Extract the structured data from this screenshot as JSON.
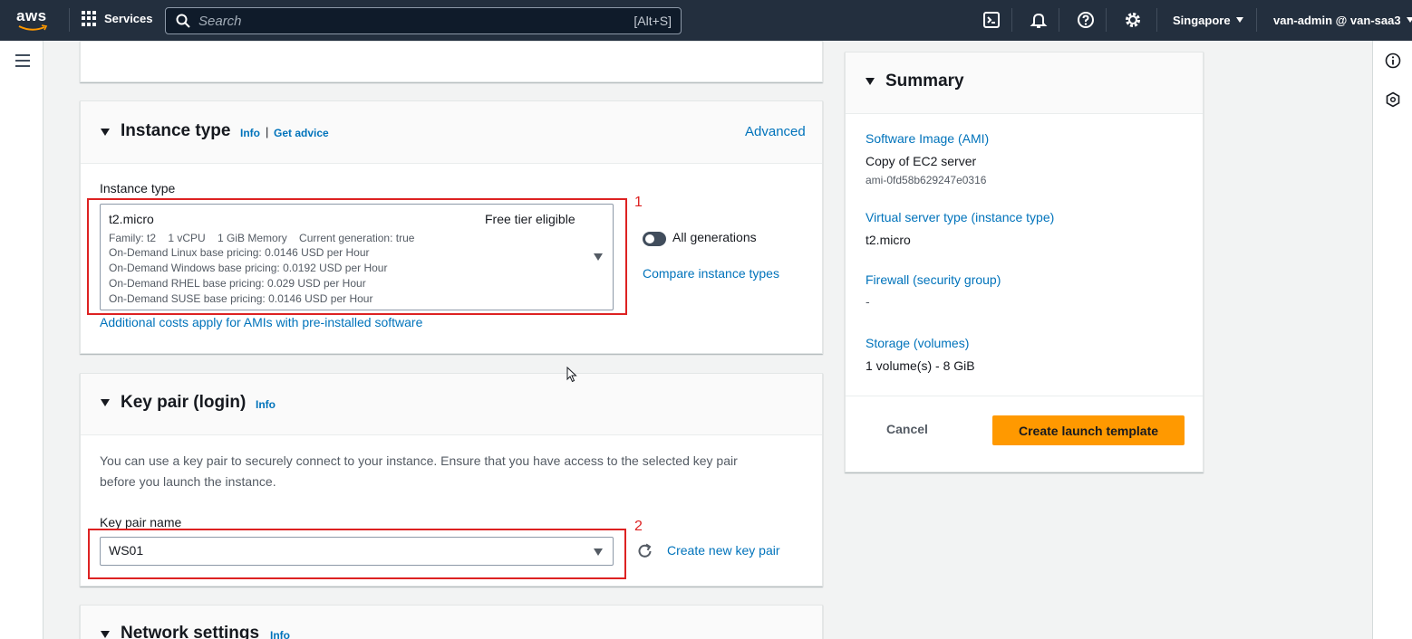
{
  "topnav": {
    "logo": "aws",
    "services_label": "Services",
    "search_placeholder": "Search",
    "search_shortcut": "[Alt+S]",
    "region": "Singapore",
    "account": "van-admin @ van-saa3",
    "icons": [
      "cloudshell-icon",
      "bell-icon",
      "help-icon",
      "gear-icon"
    ]
  },
  "instance_type_section": {
    "title": "Instance type",
    "info": "Info",
    "divider": "|",
    "get_advice": "Get advice",
    "advanced": "Advanced",
    "field_label": "Instance type",
    "selected": {
      "name": "t2.micro",
      "badge": "Free tier eligible",
      "details_line": "Family: t2    1 vCPU    1 GiB Memory    Current generation: true",
      "pricing": [
        "On-Demand Linux base pricing: 0.0146 USD per Hour",
        "On-Demand Windows base pricing: 0.0192 USD per Hour",
        "On-Demand RHEL base pricing: 0.029 USD per Hour",
        "On-Demand SUSE base pricing: 0.0146 USD per Hour"
      ]
    },
    "all_generations": "All generations",
    "compare": "Compare instance types",
    "additional_costs": "Additional costs apply for AMIs with pre-installed software",
    "annotation": "1"
  },
  "key_pair_section": {
    "title": "Key pair (login)",
    "info": "Info",
    "description_line1": "You can use a key pair to securely connect to your instance. Ensure that you have access to the selected key pair",
    "description_line2": "before you launch the instance.",
    "field_label": "Key pair name",
    "selected": "WS01",
    "create_new": "Create new key pair",
    "annotation": "2"
  },
  "network_section": {
    "title": "Network settings",
    "info": "Info"
  },
  "summary": {
    "title": "Summary",
    "ami_label": "Software Image (AMI)",
    "ami_name": "Copy of EC2 server",
    "ami_id": "ami-0fd58b629247e0316",
    "instance_label": "Virtual server type (instance type)",
    "instance_value": "t2.micro",
    "firewall_label": "Firewall (security group)",
    "firewall_value": "-",
    "storage_label": "Storage (volumes)",
    "storage_value": "1 volume(s) - 8 GiB",
    "cancel": "Cancel",
    "create": "Create launch template"
  },
  "colors": {
    "nav_bg": "#232f3e",
    "link": "#0073bb",
    "primary_button": "#ff9900",
    "annotation_red": "#dd2222"
  }
}
